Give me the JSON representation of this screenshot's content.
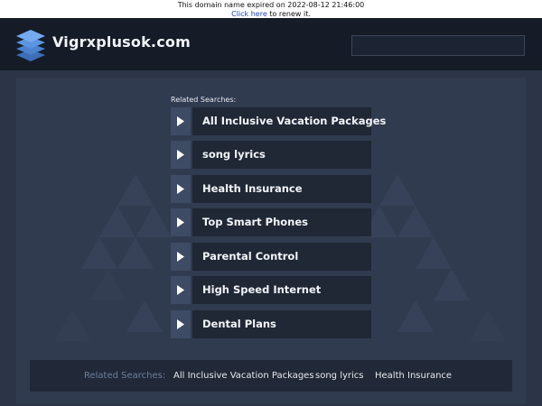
{
  "notice": {
    "expired_text": "This domain name expired on 2022-08-12 21:46:00",
    "renew_link": "Click here",
    "renew_suffix": " to renew it."
  },
  "header": {
    "site_title": "Vigrxplusok.com",
    "logo_icon": "stacked-layers-icon",
    "search_value": ""
  },
  "main": {
    "related_label": "Related Searches:",
    "links": [
      {
        "label": "All Inclusive Vacation Packages",
        "icon": "play-arrow-icon"
      },
      {
        "label": "song lyrics",
        "icon": "play-arrow-icon"
      },
      {
        "label": "Health Insurance",
        "icon": "play-arrow-icon"
      },
      {
        "label": "Top Smart Phones",
        "icon": "play-arrow-icon"
      },
      {
        "label": "Parental Control",
        "icon": "play-arrow-icon"
      },
      {
        "label": "High Speed Internet",
        "icon": "play-arrow-icon"
      },
      {
        "label": "Dental Plans",
        "icon": "play-arrow-icon"
      }
    ]
  },
  "footer": {
    "related_label": "Related Searches:",
    "links": [
      "All Inclusive Vacation Packages",
      "song lyrics",
      "Health Insurance"
    ]
  },
  "colors": {
    "page_bg": "#2a3344",
    "header_bg": "#151b27",
    "arrow_box": "#3e4b65",
    "label_box": "#202735",
    "link_blue": "#1a3fc7"
  }
}
